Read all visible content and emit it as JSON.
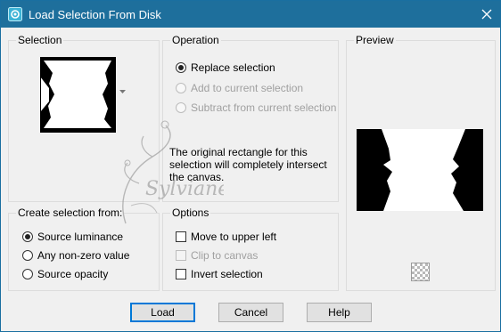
{
  "window": {
    "title": "Load Selection From Disk"
  },
  "selection_group": {
    "label": "Selection"
  },
  "operation_group": {
    "label": "Operation",
    "options": [
      {
        "label": "Replace selection",
        "checked": true,
        "enabled": true
      },
      {
        "label": "Add to current selection",
        "checked": false,
        "enabled": false
      },
      {
        "label": "Subtract from current selection",
        "checked": false,
        "enabled": false
      }
    ],
    "info": "The original rectangle for this selection will completely intersect the canvas."
  },
  "preview_group": {
    "label": "Preview",
    "transparency_icon": "checkerboard-icon"
  },
  "create_group": {
    "label": "Create selection from:",
    "options": [
      {
        "label": "Source luminance",
        "checked": true
      },
      {
        "label": "Any non-zero value",
        "checked": false
      },
      {
        "label": "Source opacity",
        "checked": false
      }
    ]
  },
  "options_group": {
    "label": "Options",
    "checks": [
      {
        "label": "Move to upper left",
        "checked": false,
        "enabled": true
      },
      {
        "label": "Clip to canvas",
        "checked": false,
        "enabled": false
      },
      {
        "label": "Invert selection",
        "checked": false,
        "enabled": true
      }
    ]
  },
  "watermark": {
    "text": "Sylviane"
  },
  "buttons": {
    "load": "Load",
    "cancel": "Cancel",
    "help": "Help"
  },
  "colors": {
    "titlebar": "#1e6f9c",
    "accent": "#0078d7"
  }
}
